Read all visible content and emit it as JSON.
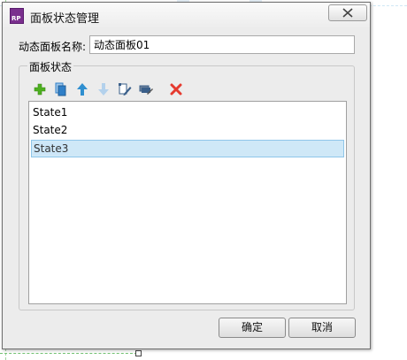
{
  "window": {
    "title": "面板状态管理",
    "app_icon_text": "RP"
  },
  "panel_name": {
    "label": "动态面板名称:",
    "value": "动态面板01"
  },
  "states_group": {
    "legend": "面板状态",
    "toolbar": [
      {
        "name": "add-state",
        "icon": "plus-icon",
        "color": "#4caf1f"
      },
      {
        "name": "duplicate-state",
        "icon": "copy-icon",
        "color": "#2f7fc8"
      },
      {
        "name": "move-up",
        "icon": "arrow-up-icon",
        "color": "#2f8fd0"
      },
      {
        "name": "move-down",
        "icon": "arrow-down-icon",
        "color": "#a8c8e6"
      },
      {
        "name": "edit-state",
        "icon": "edit-icon",
        "color": "#3a5f8a"
      },
      {
        "name": "edit-all-states",
        "icon": "edit-all-icon",
        "color": "#3a5f8a"
      },
      {
        "name": "delete-state",
        "icon": "delete-icon",
        "color": "#e53a2f"
      }
    ],
    "states": [
      "State1",
      "State2",
      "State3"
    ],
    "selected_index": 2
  },
  "buttons": {
    "ok": "确定",
    "cancel": "取消"
  },
  "colors": {
    "selection": "#cfe8f7",
    "dialog_bg": "#ececec"
  }
}
